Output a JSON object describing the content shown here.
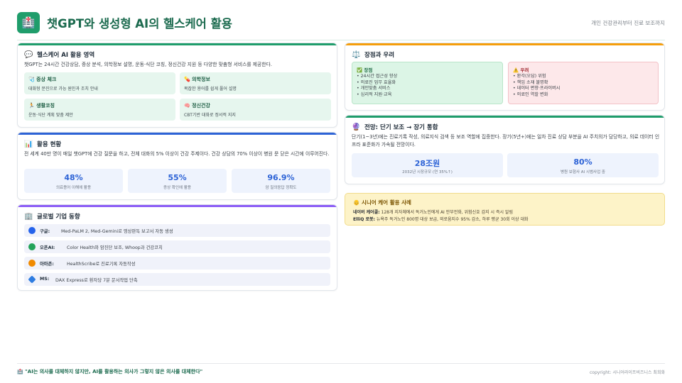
{
  "header": {
    "logo_icon": "🏥",
    "title": "챗GPT와 생성형 AI의 헬스케어 활용",
    "subtitle": "개인 건강관리부터 진료 보조까지"
  },
  "colors": {
    "brand_green": "#1f9d6b",
    "accent_blue": "#2d63d6",
    "accent_purple": "#8b5cf6",
    "accent_orange": "#f59e0b",
    "pro_green": "#dcf5e6",
    "con_red": "#fde8ea"
  },
  "usage_card": {
    "icon": "💬",
    "title": "헬스케어 AI 활용 영역",
    "description": "챗GPT는 24시간 건강상담, 증상 분석, 의학정보 설명, 운동·식단 코칭, 정신건강 지원 등 다양한 맞춤형 서비스를 제공한다.",
    "features": [
      {
        "icon": "🩺",
        "title": "증상 체크",
        "desc": "대화형 문진으로 가능 원인과 조치 안내"
      },
      {
        "icon": "💊",
        "title": "의학정보",
        "desc": "복잡한 용어를 쉽게 풀어 설명"
      },
      {
        "icon": "🏃",
        "title": "생활코칭",
        "desc": "운동·식단 계획 맞춤 제안"
      },
      {
        "icon": "🧠",
        "title": "정신건강",
        "desc": "CBT기반 대화로 정서적 지지"
      }
    ]
  },
  "status_card": {
    "icon": "📊",
    "title": "활용 현황",
    "description": "전 세계 40만 명이 매일 챗GPT에 건강 질문을 하고, 전체 대화의 5% 이상이 건강 주제이다. 건강 상담의 70% 이상이 병원 문 닫은 시간에 이루어진다.",
    "stats": [
      {
        "value": "48%",
        "label": "의료용어 이해에 활용"
      },
      {
        "value": "55%",
        "label": "증상 확인에 활용"
      },
      {
        "value": "96.9%",
        "label": "암 질의응답 정확도"
      }
    ]
  },
  "global_card": {
    "icon": "🏢",
    "title": "글로벌 기업 동향",
    "companies": [
      {
        "icon": "🔵",
        "color": "#2563eb",
        "name": "구글:",
        "text": "Med-PaLM 2, Med-Gemini로 영상판독 보고서 자동 생성"
      },
      {
        "icon": "🟢",
        "color": "#22a35a",
        "name": "오픈AI:",
        "text": "Color Health와 암진단 보조, Whoop과 건강코치"
      },
      {
        "icon": "🟠",
        "color": "#f08a00",
        "name": "아마존:",
        "text": "HealthScribe로 진료기록 자동작성"
      },
      {
        "icon": "🔷",
        "color": "#2f7de1",
        "name": "MS:",
        "text": "DAX Express로 환자당 7분 문서작업 단축"
      }
    ]
  },
  "proscons_card": {
    "icon": "⚖️",
    "title": "장점과 우려",
    "pros": {
      "icon": "✅",
      "title": "장점",
      "items": [
        "24시간 접근성 향상",
        "의료진 업무 효율화",
        "개인맞춤 서비스",
        "심리적 지원·교육"
      ]
    },
    "cons": {
      "icon": "⚠️",
      "title": "우려",
      "items": [
        "환각(오답) 위험",
        "책임 소재 불명확",
        "데이터 편향·프라이버시",
        "의료인 역할 변화"
      ]
    }
  },
  "outlook_card": {
    "icon": "🔮",
    "title": "전망: 단기 보조 → 장기 통합",
    "description": "단기(1~3년)에는 진료기록 작성, 의료지식 검색 등 보조 역할에 집중한다. 장기(5년+)에는 일차 진료 상담 부분을 AI 주치의가 담당하고, 의료 데이터 인프라 표준화가 가속될 전망이다.",
    "stats": [
      {
        "value": "28조원",
        "label": "2032년 시장규모 (연 35%↑)"
      },
      {
        "value": "80%",
        "label": "병원 보험사 AI 시범사업 중"
      }
    ]
  },
  "senior_card": {
    "icon": "👴",
    "title": "시니어 케어 활용 사례",
    "cases": [
      {
        "name": "네이버 케어콜:",
        "text": "128개 지자체에서 독거노인에게 AI 안부전화, 위험신호 감지 시 즉시 알림"
      },
      {
        "name": "ElliQ 로봇:",
        "text": "뉴욕주 독거노인 800명 대상 보급, 외로움지수 95% 감소, 하루 평균 30회 이상 대화"
      }
    ]
  },
  "footer": {
    "quote_icon": "🏥",
    "quote": "\"AI는 의사를 대체하지 않지만, AI를 활용하는 의사가 그렇지 않은 의사를 대체한다\"",
    "copyright": "copyright: 시니어라이프비즈니스 최희화"
  }
}
